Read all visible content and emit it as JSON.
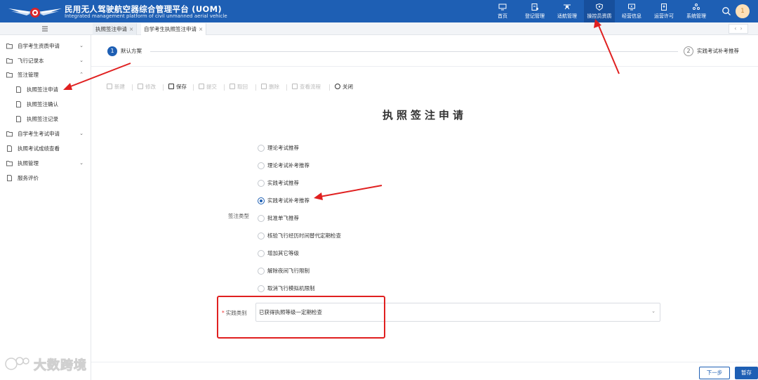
{
  "header": {
    "title_cn": "民用无人驾驶航空器综合管理平台 (UOM)",
    "title_en": "Integrated management platform of civil unmanned aerial vehicle",
    "nav": [
      {
        "label": "首页",
        "icon": "monitor-icon"
      },
      {
        "label": "登记管理",
        "icon": "document-icon"
      },
      {
        "label": "适航管理",
        "icon": "drone-icon"
      },
      {
        "label": "操控员资质",
        "icon": "shield-icon",
        "active": true
      },
      {
        "label": "经营信息",
        "icon": "display-icon"
      },
      {
        "label": "运营许可",
        "icon": "permit-icon"
      },
      {
        "label": "系统管理",
        "icon": "settings-icon"
      }
    ],
    "avatar_text": "1"
  },
  "tabs": [
    {
      "label": "执照签注申请",
      "close": "×"
    },
    {
      "label": "自学考生执照签注申请",
      "close": "×",
      "active": true
    }
  ],
  "sidebar": {
    "items": [
      {
        "label": "自学考生资质申请",
        "chevron": "⌄",
        "icon": "folder-icon"
      },
      {
        "label": "飞行记录本",
        "chevron": "⌄",
        "icon": "folder-icon"
      },
      {
        "label": "签注管理",
        "chevron": "⌃",
        "icon": "folder-icon"
      },
      {
        "label": "执照签注申请",
        "icon": "file-icon",
        "sub": true
      },
      {
        "label": "执照签注确认",
        "icon": "file-icon",
        "sub": true
      },
      {
        "label": "执照签注记录",
        "icon": "file-icon",
        "sub": true
      },
      {
        "label": "自学考生考试申请",
        "chevron": "⌄",
        "icon": "folder-icon"
      },
      {
        "label": "执照考试成绩查看",
        "icon": "file-icon"
      },
      {
        "label": "执照管理",
        "chevron": "⌄",
        "icon": "folder-icon"
      },
      {
        "label": "服务评价",
        "icon": "file-icon"
      }
    ]
  },
  "steps": [
    {
      "num": "1",
      "label": "默认方案"
    },
    {
      "num": "2",
      "label": "实践考试补考推荐"
    }
  ],
  "toolbar": {
    "new": "新建",
    "edit": "修改",
    "save": "保存",
    "submit": "提交",
    "recall": "取回",
    "delete": "删除",
    "flow": "查看流程",
    "close": "关闭"
  },
  "form": {
    "title": "执照签注申请",
    "type_label": "签注类型",
    "options": [
      "理论考试推荐",
      "理论考试补考推荐",
      "实践考试推荐",
      "实践考试补考推荐",
      "批准单飞推荐",
      "核验飞行经历时间替代定期检查",
      "增加其它等级",
      "解除夜间飞行限制",
      "取消飞行模拟机限制"
    ],
    "selected_index": 3,
    "category_required": "*",
    "category_label": "实践类别",
    "category_value": "已获得执照等级一定期检查",
    "dropdown_chevron": "⌄"
  },
  "footer": {
    "prev": "下一步",
    "save": "暂存"
  },
  "watermark": "大数跨境",
  "colors": {
    "primary": "#1e5fb4",
    "annotation": "#e02020"
  }
}
